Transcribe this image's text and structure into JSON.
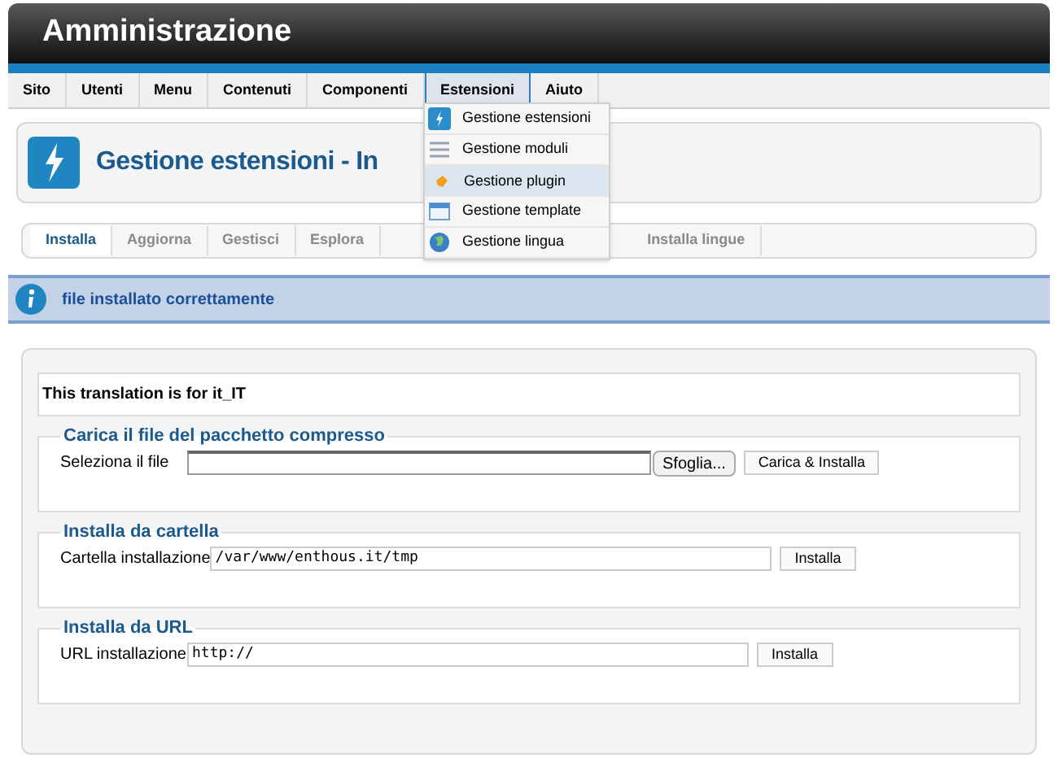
{
  "header": {
    "title": "Amministrazione"
  },
  "menu": [
    {
      "label": "Sito",
      "selected": false
    },
    {
      "label": "Utenti",
      "selected": false
    },
    {
      "label": "Menu",
      "selected": false
    },
    {
      "label": "Contenuti",
      "selected": false
    },
    {
      "label": "Componenti",
      "selected": false
    },
    {
      "label": "Estensioni",
      "selected": true
    },
    {
      "label": "Aiuto",
      "selected": false
    }
  ],
  "dropdown": [
    {
      "label": "Gestione estensioni",
      "kind": "extensions",
      "selected": false
    },
    {
      "label": "Gestione moduli",
      "kind": "modules",
      "selected": false
    },
    {
      "label": "Gestione plugin",
      "kind": "plugin",
      "selected": true
    },
    {
      "label": "Gestione template",
      "kind": "template",
      "selected": false
    },
    {
      "label": "Gestione lingua",
      "kind": "language",
      "selected": false
    }
  ],
  "page_title": "Gestione estensioni - In",
  "tabs": [
    {
      "label": "Installa",
      "selected": true
    },
    {
      "label": "Aggiorna",
      "selected": false
    },
    {
      "label": "Gestisci",
      "selected": false
    },
    {
      "label": "Esplora",
      "selected": false
    },
    {
      "label": "Installa lingue",
      "selected": false
    }
  ],
  "message": "file installato correttamente",
  "note": "This translation is for it_IT",
  "sections": [
    {
      "legend": "Carica il file del pacchetto compresso",
      "kind": "upload",
      "label": "Seleziona il file",
      "browse": "Sfoglia...",
      "button": "Carica & Installa"
    },
    {
      "legend": "Installa da cartella",
      "kind": "folder",
      "label": "Cartella installazione",
      "value": "/var/www/enthous.it/tmp",
      "button": "Installa"
    },
    {
      "legend": "Installa da URL",
      "kind": "url",
      "label": "URL installazione",
      "value": "http://",
      "button": "Installa"
    }
  ]
}
